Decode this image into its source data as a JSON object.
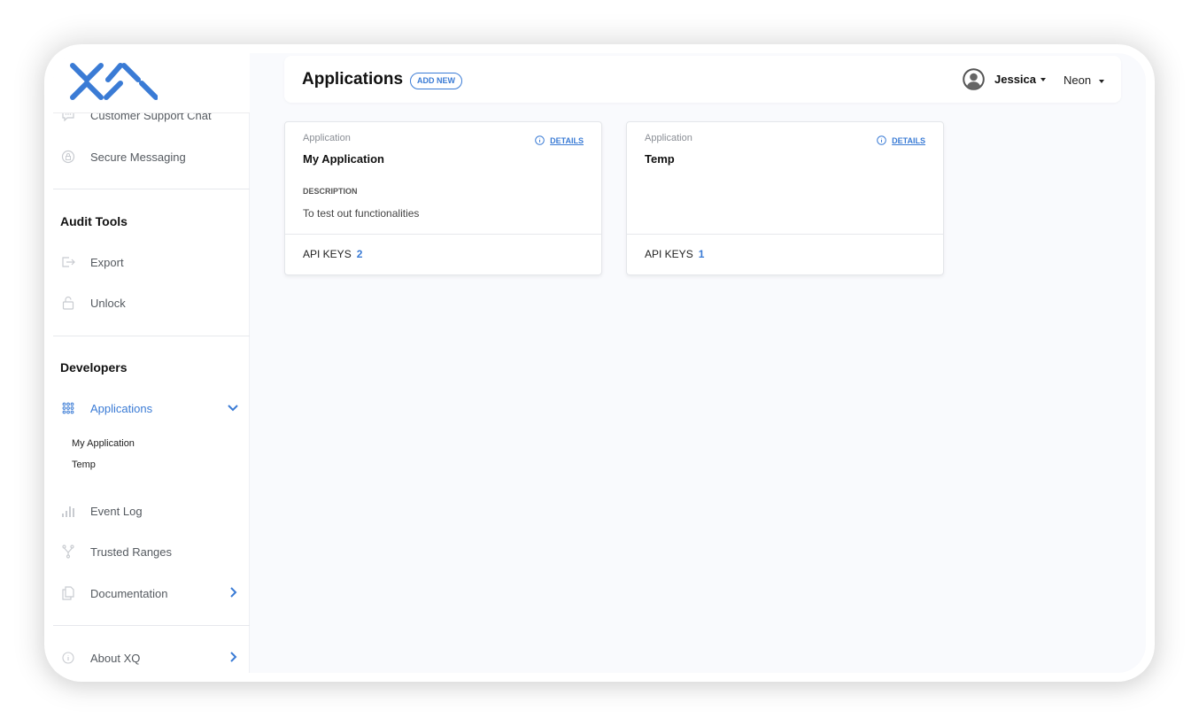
{
  "brand": {
    "logo": "xq-logo",
    "accent": "#3a7bd5"
  },
  "sidebar": {
    "partial_item": {
      "label": "Customer Support Chat",
      "icon": "chat-bubble-icon"
    },
    "secure_messaging": {
      "label": "Secure Messaging",
      "icon": "lock-bubble-icon"
    },
    "audit_tools": {
      "title": "Audit Tools",
      "items": [
        {
          "label": "Export",
          "icon": "export-icon"
        },
        {
          "label": "Unlock",
          "icon": "unlock-icon"
        }
      ]
    },
    "developers": {
      "title": "Developers",
      "applications": {
        "label": "Applications",
        "icon": "grid-dots-icon",
        "expanded": true,
        "children": [
          "My Application",
          "Temp"
        ]
      },
      "items": [
        {
          "label": "Event Log",
          "icon": "bar-chart-icon"
        },
        {
          "label": "Trusted Ranges",
          "icon": "fork-icon"
        },
        {
          "label": "Documentation",
          "icon": "documents-icon"
        }
      ]
    },
    "about": {
      "label": "About XQ",
      "icon": "info-icon"
    }
  },
  "header": {
    "title": "Applications",
    "add_new": "ADD NEW",
    "user_name": "Jessica",
    "org_name": "Neon"
  },
  "cards": [
    {
      "kind": "Application",
      "title": "My Application",
      "details": "DETAILS",
      "description_label": "DESCRIPTION",
      "description": "To test out functionalities",
      "api_keys_label": "API KEYS",
      "api_keys": "2"
    },
    {
      "kind": "Application",
      "title": "Temp",
      "details": "DETAILS",
      "api_keys_label": "API KEYS",
      "api_keys": "1"
    }
  ]
}
